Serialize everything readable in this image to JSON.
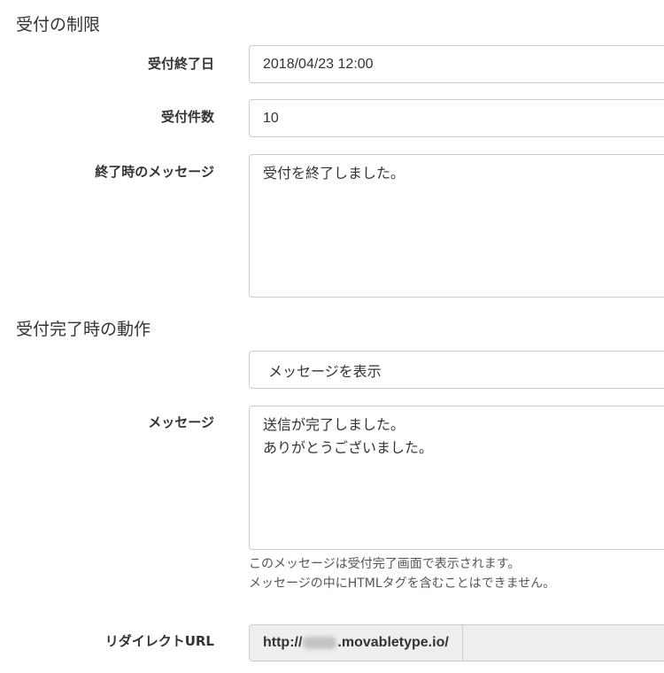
{
  "sections": {
    "restriction_title": "受付の制限",
    "completion_title": "受付完了時の動作"
  },
  "fields": {
    "end_date": {
      "label": "受付終了日",
      "value": "2018/04/23 12:00"
    },
    "count": {
      "label": "受付件数",
      "value": "10"
    },
    "end_message": {
      "label": "終了時のメッセージ",
      "value": "受付を終了しました。"
    },
    "action": {
      "selected": "メッセージを表示"
    },
    "message": {
      "label": "メッセージ",
      "value": "送信が完了しました。\nありがとうございました。",
      "help_line1": "このメッセージは受付完了画面で表示されます。",
      "help_line2": "メッセージの中にHTMLタグを含むことはできません。"
    },
    "redirect": {
      "label": "リダイレクトURL",
      "prefix_start": "http://",
      "prefix_end": ".movabletype.io/"
    }
  },
  "colors": {
    "border": "#cccccc",
    "addon_bg": "#eeeeee",
    "text": "#333333",
    "help_text": "#555555"
  }
}
